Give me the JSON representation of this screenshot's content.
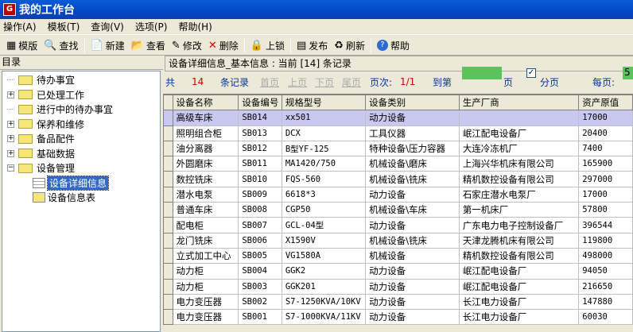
{
  "window": {
    "title": "我的工作台"
  },
  "menu": [
    "操作(A)",
    "模板(T)",
    "查询(V)",
    "选项(P)",
    "帮助(H)"
  ],
  "toolbar": [
    {
      "icon": "▦",
      "label": "模版"
    },
    {
      "icon": "🔍",
      "label": "查找"
    },
    {
      "sep": true
    },
    {
      "icon": "📄",
      "label": "新建"
    },
    {
      "icon": "📂",
      "label": "查看"
    },
    {
      "icon": "✎",
      "label": "修改"
    },
    {
      "icon": "✕",
      "label": "删除"
    },
    {
      "sep": true
    },
    {
      "icon": "🔒",
      "label": "上锁"
    },
    {
      "sep": true
    },
    {
      "icon": "▤",
      "label": "发布"
    },
    {
      "icon": "♻",
      "label": "刷新"
    },
    {
      "sep": true
    },
    {
      "icon": "?",
      "label": "帮助"
    }
  ],
  "sidebar": {
    "title": "目录",
    "items": [
      {
        "label": "待办事宜",
        "pm": ""
      },
      {
        "label": "已处理工作",
        "pm": "+"
      },
      {
        "label": "进行中的待办事宜",
        "pm": ""
      },
      {
        "label": "保养和维修",
        "pm": "+"
      },
      {
        "label": "备品配件",
        "pm": "+"
      },
      {
        "label": "基础数据",
        "pm": "+"
      },
      {
        "label": "设备管理",
        "pm": "−"
      }
    ],
    "children": [
      {
        "label": "设备详细信息",
        "selected": true
      },
      {
        "label": "设备信息表"
      }
    ]
  },
  "info": {
    "text": "设备详细信息_基本信息 :  当前  [14]  条记录"
  },
  "pager": {
    "total_prefix": "共",
    "total": "14",
    "total_suffix": "条记录",
    "first": "首页",
    "prev": "上页",
    "next": "下页",
    "last": "尾页",
    "page_label": "页次:",
    "page": "1/1",
    "goto_label": "到第",
    "goto_suffix": "页",
    "paging_label": "分页",
    "paging_checked": true,
    "per_page_label": "每页:",
    "per_page": "5"
  },
  "table": {
    "columns": [
      "设备名称",
      "设备编号",
      "规格型号",
      "设备类别",
      "生产厂商",
      "资产原值"
    ],
    "rows": [
      [
        "高级车床",
        "SB014",
        "xx501",
        "动力设备",
        "",
        "17000"
      ],
      [
        "照明组合柜",
        "SB013",
        "DCX",
        "工具仪器",
        "岷江配电设备厂",
        "20400"
      ],
      [
        "油分离器",
        "SB012",
        "B型YF-125",
        "特种设备\\压力容器",
        "大连冷冻机厂",
        "7400"
      ],
      [
        "外圆磨床",
        "SB011",
        "MA1420/750",
        "机械设备\\磨床",
        "上海兴华机床有限公司",
        "165900"
      ],
      [
        "数控铣床",
        "SB010",
        "FQS-560",
        "机械设备\\铣床",
        "精机数控设备有限公司",
        "297000"
      ],
      [
        "潜水电泵",
        "SB009",
        "6618*3",
        "动力设备",
        "石家庄潜水电泵厂",
        "17000"
      ],
      [
        "普通车床",
        "SB008",
        "CGP50",
        "机械设备\\车床",
        "第一机床厂",
        "57800"
      ],
      [
        "配电柜",
        "SB007",
        "GCL-04型",
        "动力设备",
        "广东电力电子控制设备厂",
        "396544"
      ],
      [
        "龙门铣床",
        "SB006",
        "X1590V",
        "机械设备\\铣床",
        "天津龙腾机床有限公司",
        "119800"
      ],
      [
        "立式加工中心",
        "SB005",
        "VG1580A",
        "机械设备",
        "精机数控设备有限公司",
        "498000"
      ],
      [
        "动力柜",
        "SB004",
        "GGK2",
        "动力设备",
        "岷江配电设备厂",
        "94050"
      ],
      [
        "动力柜",
        "SB003",
        "GGK201",
        "动力设备",
        "岷江配电设备厂",
        "216650"
      ],
      [
        "电力变压器",
        "SB002",
        "S7-1250KVA/10KV",
        "动力设备",
        "长江电力设备厂",
        "147880"
      ],
      [
        "电力变压器",
        "SB001",
        "S7-1000KVA/11KV",
        "动力设备",
        "长江电力设备厂",
        "60030"
      ]
    ]
  }
}
